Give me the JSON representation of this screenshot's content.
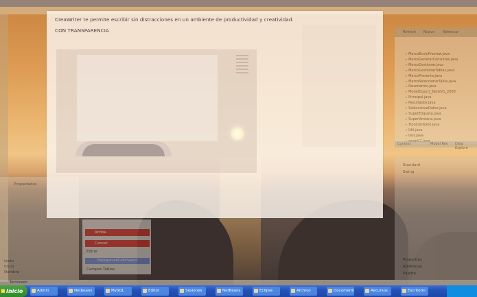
{
  "creawriter": {
    "line1": "CreaWriter te permite escribir sin distracciones en un ambiente de productividad y creatividad.",
    "line2": "CON TRANSPARENCIA"
  },
  "ide": {
    "palette": {
      "button1": "Arriba",
      "button2": "Cancel",
      "label1": "Editar",
      "selected": "BackgroundColorSelect",
      "label2": "Campos Tablas"
    },
    "left_panel": {
      "label": "Propiedades",
      "rows": [
        "texto",
        "titulo",
        "Nombre"
      ]
    },
    "right_panel": {
      "head": [
        "Refresh",
        "Nuevo",
        "Refrescar"
      ],
      "files": [
        "MarcoEnvioPreview.java",
        "MarcoGenerarConsultas.java",
        "MarcoGestionar.java",
        "MarcoGestionarTablas.java",
        "MarcoPresenta.java",
        "MarcoSeleccionarTabla.java",
        "Parametros.java",
        "ModelExport_TableV1_2008",
        "Principal.java",
        "Resultados.java",
        "SeleccionarDatos.java",
        "SuperEtiqueta.java",
        "SuperVentana.java",
        "TipoContexto.java",
        "Util.java",
        "test.java",
        "swapV1.java"
      ],
      "tabs": [
        "Context",
        "Model Rev",
        "Data Explore"
      ],
      "section_items": [
        "Standard",
        "Swing",
        "Properties",
        "Additional",
        "Palette"
      ]
    },
    "status": "Terminado"
  },
  "taskbar": {
    "start_label": "Inicio",
    "items": [
      "Admin",
      "Netbeans",
      "MySQL",
      "Editor",
      "Sesiones",
      "NetBeans",
      "Eclipse",
      "Archivo",
      "Documento",
      "Recursos",
      "Escritorio"
    ]
  }
}
